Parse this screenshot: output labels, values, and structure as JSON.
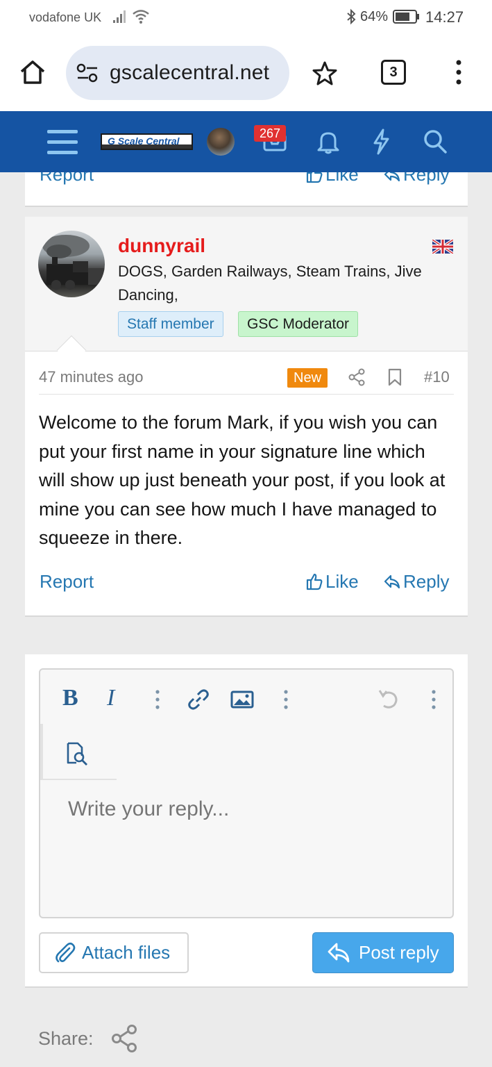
{
  "status_bar": {
    "carrier": "vodafone UK",
    "battery": "64%",
    "time": "14:27"
  },
  "browser": {
    "url": "gscalecentral.net",
    "tab_count": "3"
  },
  "forum_nav": {
    "logo_text": "G Scale Central",
    "inbox_count": "267",
    "brand_color": "#1554a3"
  },
  "previous_post": {
    "report": "Report",
    "like": "Like",
    "reply": "Reply"
  },
  "post": {
    "username": "dunnyrail",
    "user_title": "DOGS, Garden Railways, Steam Trains, Jive Dancing,",
    "badges": [
      "Staff member",
      "GSC Moderator"
    ],
    "time": "47 minutes ago",
    "new_label": "New",
    "number": "#10",
    "body": "Welcome to the forum Mark, if you wish you can put your first name in your signature line which will show up just beneath your post, if you look at mine you can see how much I have managed to squeeze in there.",
    "actions": {
      "report": "Report",
      "like": "Like",
      "reply": "Reply"
    }
  },
  "editor": {
    "bold": "B",
    "italic": "I",
    "placeholder": "Write your reply...",
    "attach": "Attach files",
    "post_reply": "Post reply"
  },
  "footer": {
    "share_label": "Share:"
  }
}
